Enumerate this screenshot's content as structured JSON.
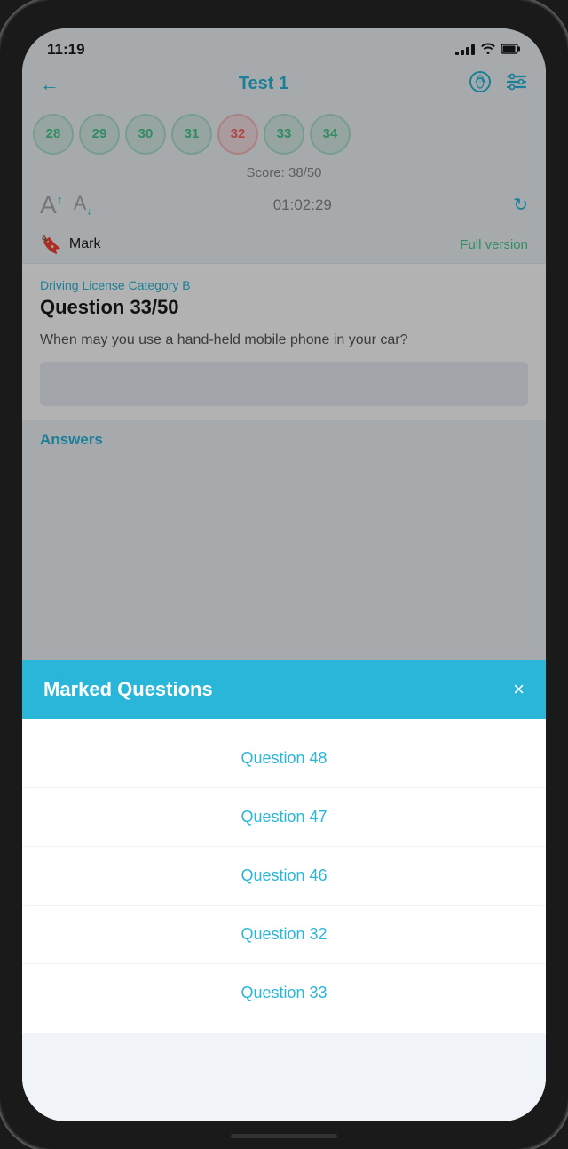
{
  "statusBar": {
    "time": "11:19",
    "signalBars": [
      3,
      5,
      7,
      9
    ],
    "wifiLabel": "wifi",
    "batteryLabel": "battery"
  },
  "header": {
    "backLabel": "←",
    "title": "Test 1",
    "syncIcon": "☁",
    "settingsIcon": "⚙"
  },
  "questionNumbers": [
    {
      "num": "28",
      "state": "green"
    },
    {
      "num": "29",
      "state": "green"
    },
    {
      "num": "30",
      "state": "green"
    },
    {
      "num": "31",
      "state": "green"
    },
    {
      "num": "32",
      "state": "red"
    },
    {
      "num": "33",
      "state": "green"
    },
    {
      "num": "34",
      "state": "green"
    }
  ],
  "score": "Score: 38/50",
  "fontControls": {
    "largeFontLabel": "A",
    "smallFontLabel": "A"
  },
  "timer": "01:02:29",
  "refreshIcon": "↻",
  "mark": {
    "bookmarkIcon": "🔖",
    "label": "Mark",
    "fullVersionLabel": "Full version"
  },
  "question": {
    "categoryLabel": "Driving License Category B",
    "questionNumber": "Question 33/50",
    "questionText": "When may you use a hand-held mobile phone in your car?"
  },
  "answersTitle": "Answers",
  "modal": {
    "title": "Marked Questions",
    "closeIcon": "×",
    "items": [
      {
        "label": "Question 48"
      },
      {
        "label": "Question 47"
      },
      {
        "label": "Question 46"
      },
      {
        "label": "Question 32"
      },
      {
        "label": "Question 33"
      }
    ]
  }
}
